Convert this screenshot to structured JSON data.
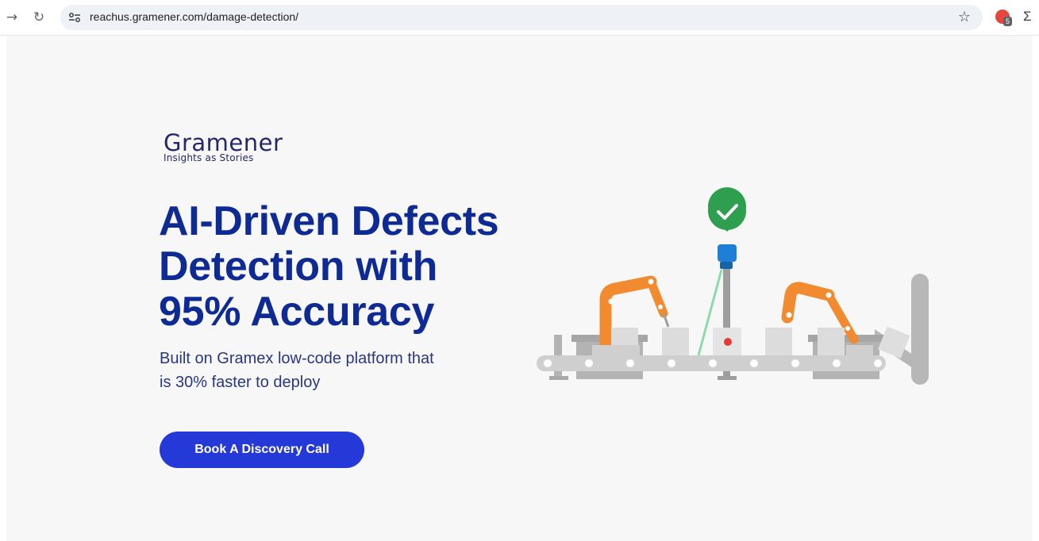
{
  "browser": {
    "back_icon": "arrow-right-icon",
    "reload_icon": "reload-icon",
    "site_info_icon": "tune-icon",
    "url": "reachus.gramener.com/damage-detection/",
    "bookmark_icon": "star-icon",
    "extension_badge_count": "5"
  },
  "logo": {
    "name": "Gramener",
    "tagline": "Insights as Stories"
  },
  "hero": {
    "headline_line1": "AI-Driven Defects",
    "headline_line2": "Detection with",
    "headline_line3": "95% Accuracy",
    "subtitle_line1": "Built on Gramex low-code platform that",
    "subtitle_line2": "is 30% faster to deploy",
    "cta_label": "Book A Discovery Call"
  },
  "colors": {
    "headline": "#0e2a94",
    "cta_bg": "#2539d8",
    "robot_arm": "#f28a30",
    "check_badge": "#2e9e4f",
    "sensor": "#1f7fd6",
    "defect_dot": "#e53935"
  }
}
